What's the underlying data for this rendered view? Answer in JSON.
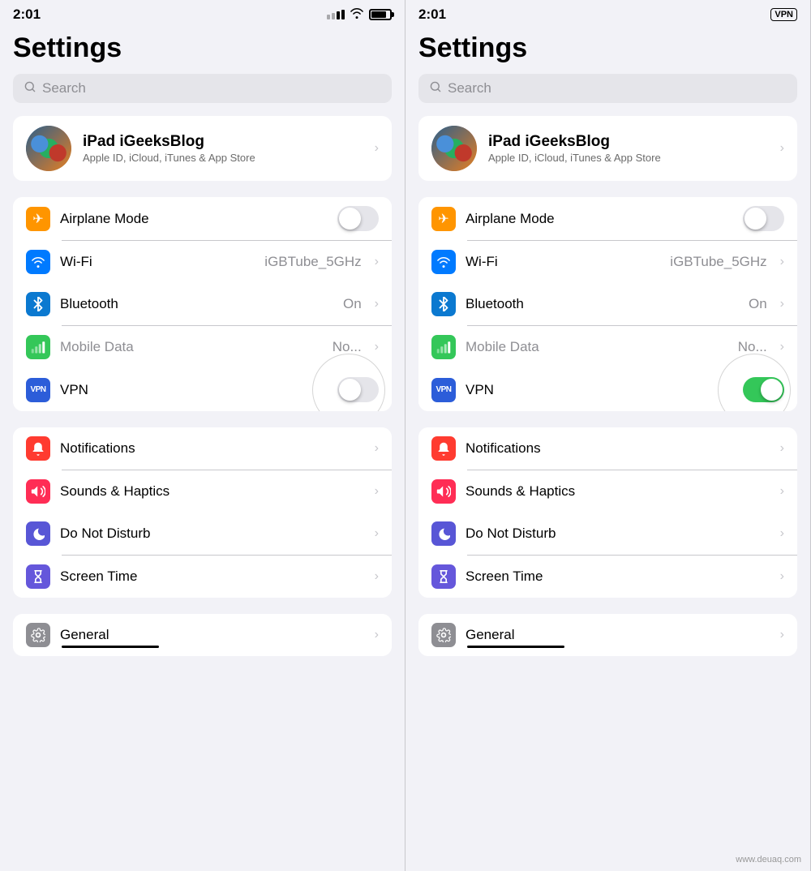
{
  "panels": [
    {
      "id": "left",
      "status": {
        "time": "2:01",
        "vpn": false
      },
      "title": "Settings",
      "search_placeholder": "Search",
      "profile": {
        "name": "iPad iGeeksBlog",
        "subtitle": "Apple ID, iCloud, iTunes & App Store"
      },
      "connectivity": [
        {
          "id": "airplane",
          "label": "Airplane Mode",
          "icon": "✈",
          "icon_class": "icon-orange",
          "type": "toggle",
          "value": false
        },
        {
          "id": "wifi",
          "label": "Wi-Fi",
          "icon": "wifi",
          "icon_class": "icon-blue",
          "type": "value",
          "value": "iGBTube_5GHz"
        },
        {
          "id": "bluetooth",
          "label": "Bluetooth",
          "icon": "bluetooth",
          "icon_class": "icon-blue-dark",
          "type": "value",
          "value": "On"
        },
        {
          "id": "mobile-data",
          "label": "Mobile Data",
          "icon": "cellular",
          "icon_class": "icon-green",
          "type": "value",
          "value": "No...",
          "dimmed": true
        },
        {
          "id": "vpn",
          "label": "VPN",
          "icon": "VPN",
          "icon_class": "icon-vpn",
          "type": "toggle",
          "value": false,
          "highlighted": true
        }
      ],
      "general": [
        {
          "id": "notifications",
          "label": "Notifications",
          "icon": "notif",
          "icon_class": "icon-red"
        },
        {
          "id": "sounds",
          "label": "Sounds & Haptics",
          "icon": "sound",
          "icon_class": "icon-pink"
        },
        {
          "id": "dnd",
          "label": "Do Not Disturb",
          "icon": "moon",
          "icon_class": "icon-purple"
        },
        {
          "id": "screen-time",
          "label": "Screen Time",
          "icon": "hourglass",
          "icon_class": "icon-indigo"
        }
      ],
      "bottom": [
        {
          "id": "general",
          "label": "General",
          "icon": "gear",
          "icon_class": "icon-gray"
        }
      ]
    },
    {
      "id": "right",
      "status": {
        "time": "2:01",
        "vpn": true
      },
      "title": "Settings",
      "search_placeholder": "Search",
      "profile": {
        "name": "iPad iGeeksBlog",
        "subtitle": "Apple ID, iCloud, iTunes & App Store"
      },
      "connectivity": [
        {
          "id": "airplane",
          "label": "Airplane Mode",
          "icon": "✈",
          "icon_class": "icon-orange",
          "type": "toggle",
          "value": false
        },
        {
          "id": "wifi",
          "label": "Wi-Fi",
          "icon": "wifi",
          "icon_class": "icon-blue",
          "type": "value",
          "value": "iGBTube_5GHz"
        },
        {
          "id": "bluetooth",
          "label": "Bluetooth",
          "icon": "bluetooth",
          "icon_class": "icon-blue-dark",
          "type": "value",
          "value": "On"
        },
        {
          "id": "mobile-data",
          "label": "Mobile Data",
          "icon": "cellular",
          "icon_class": "icon-green",
          "type": "value",
          "value": "No...",
          "dimmed": true
        },
        {
          "id": "vpn",
          "label": "VPN",
          "icon": "VPN",
          "icon_class": "icon-vpn",
          "type": "toggle",
          "value": true,
          "highlighted": true
        }
      ],
      "general": [
        {
          "id": "notifications",
          "label": "Notifications",
          "icon": "notif",
          "icon_class": "icon-red"
        },
        {
          "id": "sounds",
          "label": "Sounds & Haptics",
          "icon": "sound",
          "icon_class": "icon-pink"
        },
        {
          "id": "dnd",
          "label": "Do Not Disturb",
          "icon": "moon",
          "icon_class": "icon-purple"
        },
        {
          "id": "screen-time",
          "label": "Screen Time",
          "icon": "hourglass",
          "icon_class": "icon-indigo"
        }
      ],
      "bottom": [
        {
          "id": "general",
          "label": "General",
          "icon": "gear",
          "icon_class": "icon-gray"
        }
      ]
    }
  ],
  "watermark": "www.deuaq.com"
}
